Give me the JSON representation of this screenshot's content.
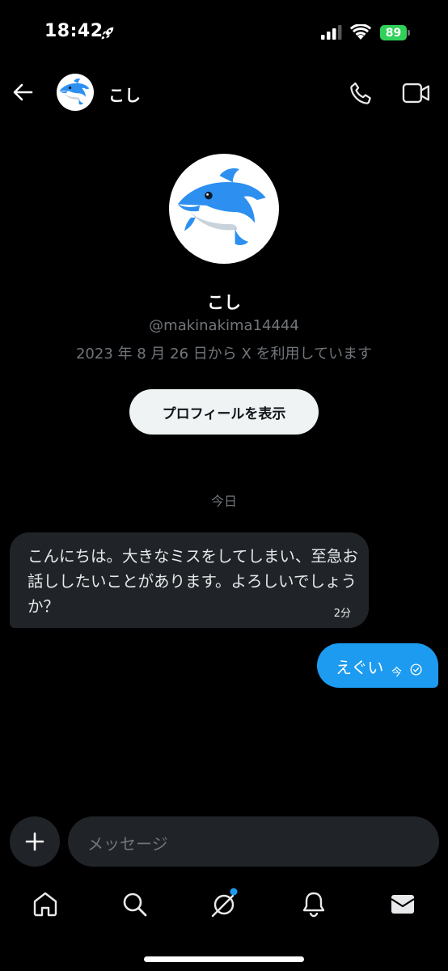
{
  "status_bar": {
    "time": "18:42",
    "battery": "89",
    "battery_color": "#30d158"
  },
  "header": {
    "name": "こし"
  },
  "profile": {
    "name": "こし",
    "handle": "@makinakima14444",
    "joined": "2023 年 8 月 26 日から X を利用しています",
    "view_profile_label": "プロフィールを表示"
  },
  "conversation": {
    "date_divider": "今日",
    "messages": [
      {
        "direction": "incoming",
        "text": "こんにちは。大きなミスをしてしまい、至急お話ししたいことがあります。よろしいでしょうか？",
        "time": "2分"
      },
      {
        "direction": "outgoing",
        "text": "えぐい",
        "time": "今",
        "status_icon": "read-check-icon"
      }
    ]
  },
  "composer": {
    "placeholder": "メッセージ"
  },
  "bottom_nav": {
    "items": [
      {
        "icon": "home-icon"
      },
      {
        "icon": "search-icon"
      },
      {
        "icon": "grok-icon",
        "has_badge": true
      },
      {
        "icon": "bell-icon"
      },
      {
        "icon": "mail-icon",
        "active": true
      }
    ]
  },
  "colors": {
    "accent": "#1d9bf0",
    "bubble_incoming": "#202327",
    "muted_text": "#71767b"
  }
}
